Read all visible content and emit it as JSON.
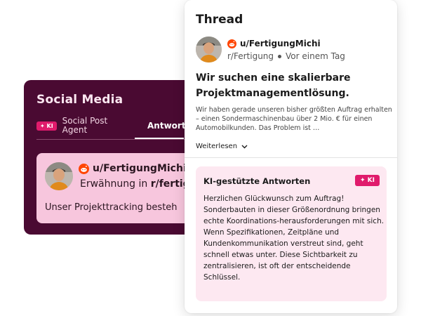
{
  "social": {
    "title": "Social Media",
    "agent_badge": "✦ KI",
    "tab_agent": "Social Post Agent",
    "tab_answers": "Antworten",
    "mention": {
      "username": "u/FertigungMichi",
      "line_prefix": "Erwähnung in ",
      "line_sub": "r/fertig",
      "snippet": "Unser Projekttracking besteh"
    }
  },
  "thread": {
    "title": "Thread",
    "post": {
      "username": "u/FertigungMichi",
      "subreddit": "r/Fertigung",
      "time": "Vor einem Tag",
      "title": "Wir suchen eine skalierbare Projektmanagementlösung.",
      "body": "Wir haben gerade unseren bisher größten Auftrag erhalten – einen Sondermaschinenbau über 2 Mio. € für einen Automobilkunden. Das Problem ist …",
      "read_more": "Weiterlesen"
    },
    "ai_answers": {
      "title": "KI-gestützte Antworten",
      "badge": "✦ KI",
      "text": "Herzlichen Glückwunsch zum Auftrag! Sonderbauten in dieser Größenordnung bringen echte Koordinations-herausforderungen mit sich. Wenn Spezifikationen, Zeitpläne und Kundenkommunikation verstreut sind, geht schnell etwas unter. Diese Sichtbarkeit zu zentralisieren, ist oft der entscheidende Schlüssel."
    }
  },
  "colors": {
    "panel_bg": "#4a0a32",
    "accent": "#e01b6c",
    "mention_bg": "#f7c6dd",
    "ai_bg": "#fde8f1"
  },
  "icons": [
    "reddit-icon",
    "sparkle-icon",
    "chevron-down-icon",
    "avatar"
  ]
}
